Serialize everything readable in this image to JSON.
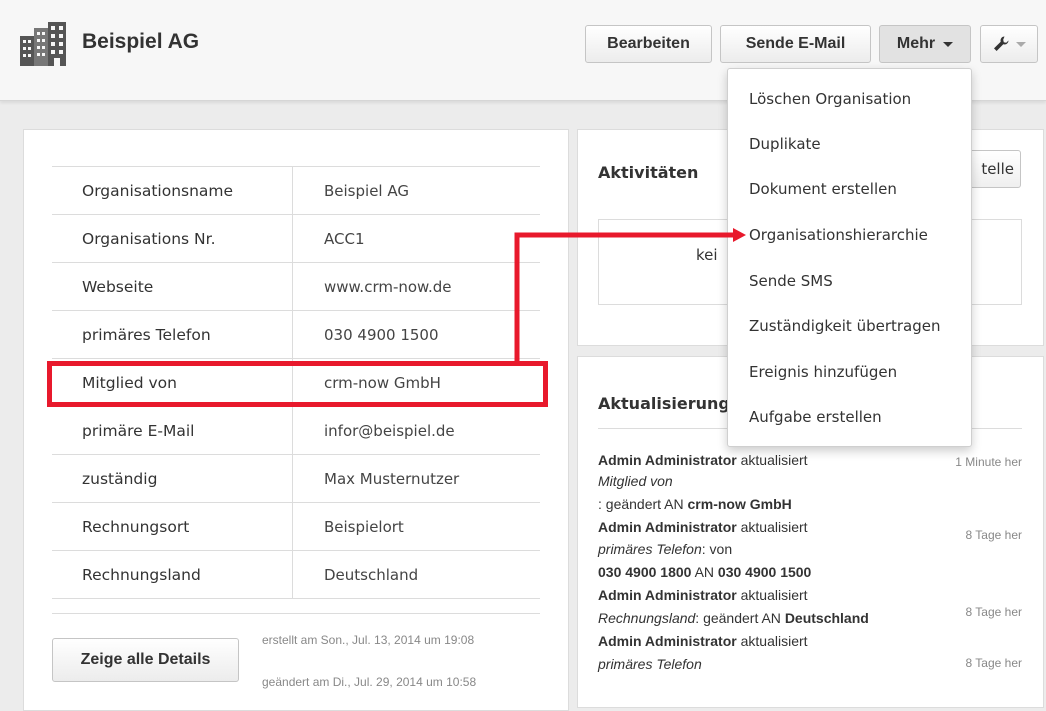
{
  "header": {
    "org_name": "Beispiel AG",
    "buttons": {
      "edit": "Bearbeiten",
      "send_email": "Sende E-Mail",
      "more": "Mehr"
    }
  },
  "dropdown": {
    "items": [
      "Löschen Organisation",
      "Duplikate",
      "Dokument erstellen",
      "Organisationshierarchie",
      "Sende SMS",
      "Zuständigkeit übertragen",
      "Ereignis hinzufügen",
      "Aufgabe erstellen"
    ]
  },
  "details": {
    "rows": [
      {
        "label": "Organisationsname",
        "value": "Beispiel AG"
      },
      {
        "label": "Organisations Nr.",
        "value": "ACC1"
      },
      {
        "label": "Webseite",
        "value": "www.crm-now.de"
      },
      {
        "label": "primäres Telefon",
        "value": "030 4900 1500"
      },
      {
        "label": "Mitglied von",
        "value": "crm-now GmbH"
      },
      {
        "label": "primäre E-Mail",
        "value": "infor@beispiel.de"
      },
      {
        "label": "zuständig",
        "value": "Max Musternutzer"
      },
      {
        "label": "Rechnungsort",
        "value": "Beispielort"
      },
      {
        "label": "Rechnungsland",
        "value": "Deutschland"
      }
    ],
    "show_all_label": "Zeige alle Details",
    "created": "erstellt am Son., Jul. 13, 2014 um 19:08",
    "modified": "geändert am Di., Jul. 29, 2014 um 10:58"
  },
  "activities": {
    "title": "Aktivitäten",
    "button_visible_text": "telle",
    "empty_visible_text": "kei"
  },
  "updates": {
    "title": "Aktualisierung",
    "feed": [
      {
        "user": "Admin Administrator",
        "action": "aktualisiert",
        "time": "1 Minute her",
        "field": "Mitglied von",
        "change_prefix": ": geändert AN",
        "new_value": "crm-now GmbH"
      },
      {
        "user": "Admin Administrator",
        "action": "aktualisiert",
        "time": "8 Tage her",
        "field": "primäres Telefon",
        "change_prefix": ": von",
        "old_value": "030 4900 1800",
        "an": "AN",
        "new_value": "030 4900 1500"
      },
      {
        "user": "Admin Administrator",
        "action": "aktualisiert",
        "time": "8 Tage her",
        "field": "Rechnungsland",
        "change_prefix": ": geändert AN",
        "new_value": "Deutschland"
      },
      {
        "user": "Admin Administrator",
        "action": "aktualisiert",
        "time": "8 Tage her",
        "field": "primäres Telefon"
      }
    ]
  },
  "colors": {
    "highlight": "#e8192c",
    "page_bg": "#ececec"
  },
  "icons": [
    "building-icon",
    "wrench-icon",
    "caret-down-icon"
  ]
}
